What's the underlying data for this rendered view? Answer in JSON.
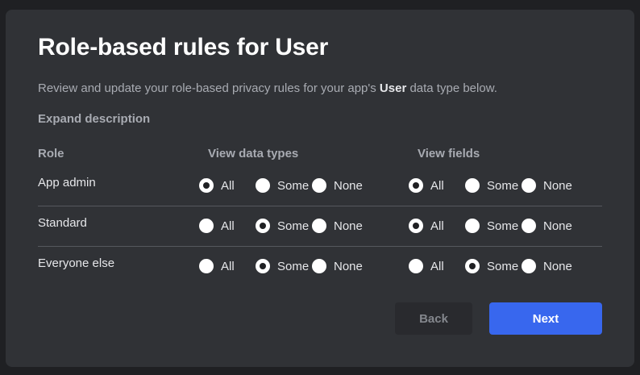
{
  "dialog": {
    "title": "Role-based rules for User",
    "description_prefix": "Review and update your role-based privacy rules for your app's ",
    "description_bold": "User",
    "description_suffix": " data type below.",
    "expand_label": "Expand description"
  },
  "table": {
    "headers": {
      "role": "Role",
      "view_data_types": "View data types",
      "view_fields": "View fields"
    },
    "option_labels": {
      "all": "All",
      "some": "Some",
      "none": "None"
    },
    "rows": [
      {
        "role": "App admin",
        "view_data_types": "All",
        "view_fields": "All"
      },
      {
        "role": "Standard",
        "view_data_types": "Some",
        "view_fields": "All"
      },
      {
        "role": "Everyone else",
        "view_data_types": "Some",
        "view_fields": "Some"
      }
    ]
  },
  "actions": {
    "back_label": "Back",
    "next_label": "Next"
  },
  "colors": {
    "background": "#303236",
    "primary": "#3867ee",
    "text": "#e6e7ea",
    "muted": "#a8abb2"
  }
}
